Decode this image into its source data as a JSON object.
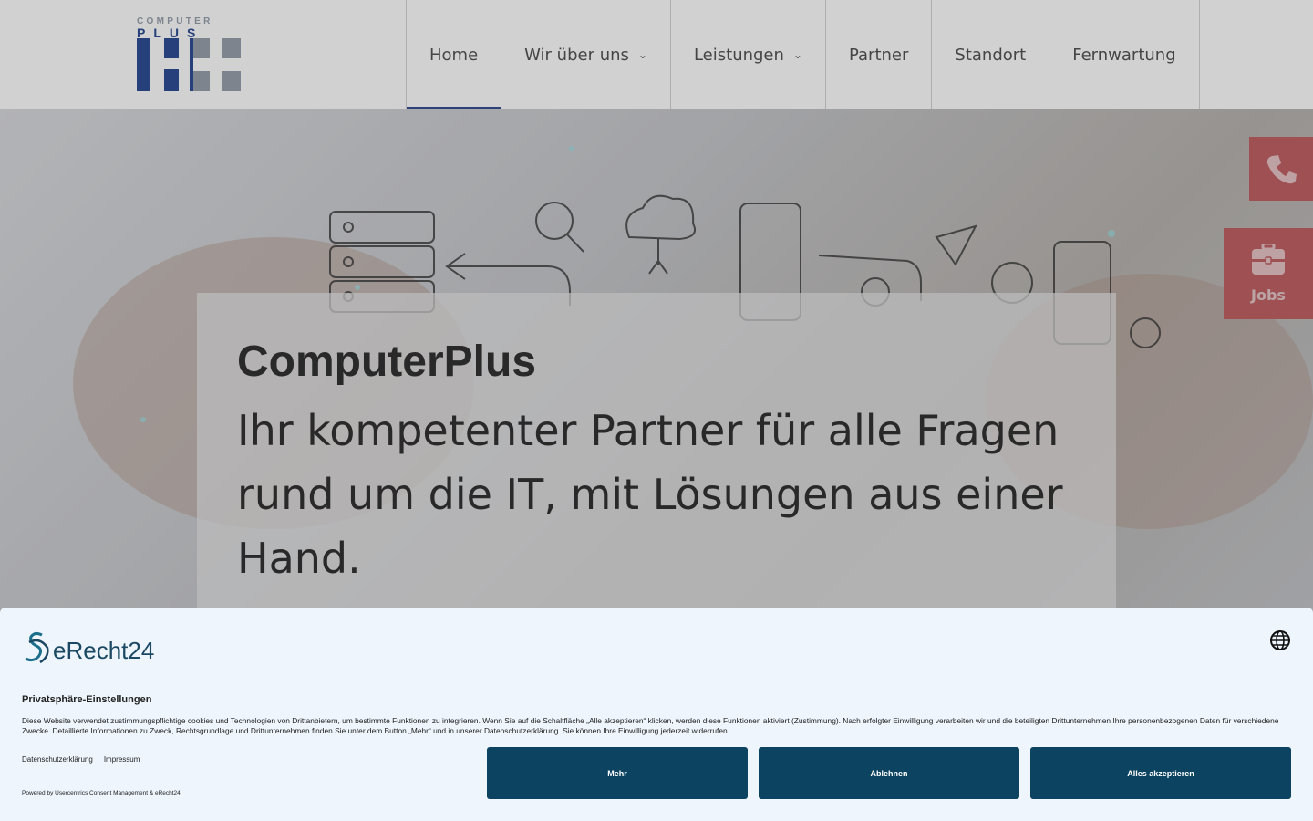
{
  "header": {
    "logo": {
      "top_text": "COMPUTER",
      "plus_text": "PLUS"
    },
    "nav": [
      {
        "label": "Home",
        "active": true,
        "has_dropdown": false
      },
      {
        "label": "Wir über uns",
        "active": false,
        "has_dropdown": true
      },
      {
        "label": "Leistungen",
        "active": false,
        "has_dropdown": true
      },
      {
        "label": "Partner",
        "active": false,
        "has_dropdown": false
      },
      {
        "label": "Standort",
        "active": false,
        "has_dropdown": false
      },
      {
        "label": "Fernwartung",
        "active": false,
        "has_dropdown": false
      }
    ]
  },
  "hero": {
    "title": "ComputerPlus",
    "subtitle": "Ihr kompetenter Partner für alle Fragen rund um die IT, mit Lösungen aus einer Hand."
  },
  "side_tabs": {
    "phone_icon": "phone-icon",
    "jobs_label": "Jobs",
    "jobs_icon": "briefcase-icon"
  },
  "consent": {
    "brand": "eRecht24",
    "title": "Privatsphäre-Einstellungen",
    "text": "Diese Website verwendet zustimmungspflichtige cookies und Technologien von Drittanbietern, um bestimmte Funktionen zu integrieren. Wenn Sie auf die Schaltfläche „Alle akzeptieren“ klicken, werden diese Funktionen aktiviert (Zustimmung). Nach erfolgter Einwilligung verarbeiten wir und die beteiligten Drittunternehmen Ihre personenbezogenen Daten für verschiedene Zwecke. Detaillierte Informationen zu Zweck, Rechtsgrundlage und Drittunternehmen finden Sie unter dem Button „Mehr“ und in unserer Datenschutzerklärung. Sie können Ihre Einwilligung jederzeit widerrufen.",
    "link_privacy": "Datenschutzerklärung",
    "link_imprint": "Impressum",
    "powered": "Powered by Usercentrics Consent Management & eRecht24",
    "btn_more": "Mehr",
    "btn_decline": "Ablehnen",
    "btn_accept": "Alles akzeptieren"
  },
  "colors": {
    "brand_blue": "#2f4f96",
    "accent_red": "#c36266",
    "consent_button": "#0c4360"
  }
}
